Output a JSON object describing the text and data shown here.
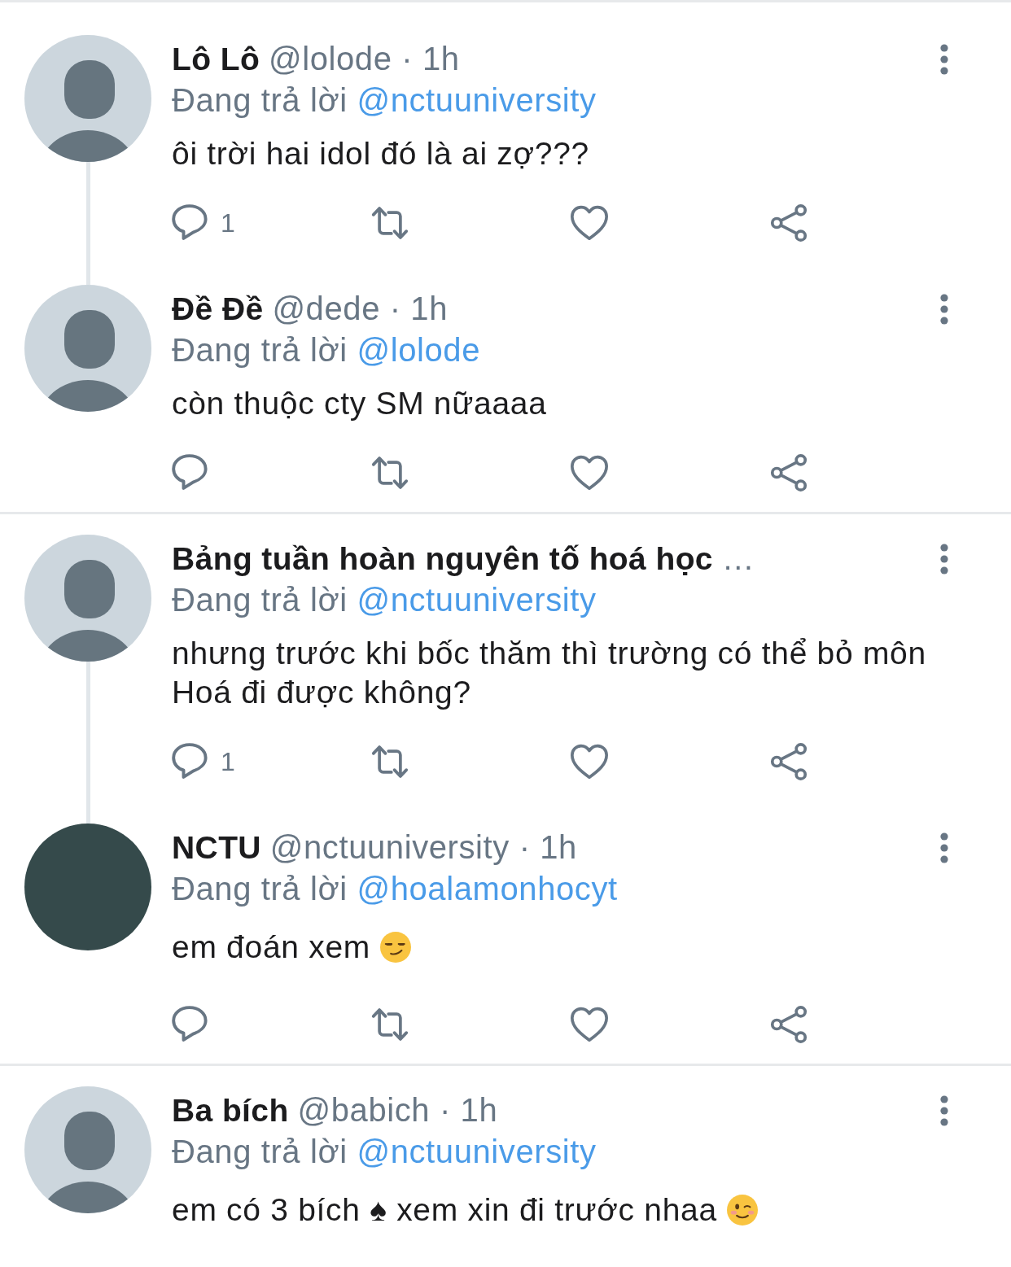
{
  "threads": [
    {
      "tweets": [
        {
          "avatar": {
            "kind": "silhouette"
          },
          "name": "Lô Lô",
          "meta": "@lolode · 1h",
          "reply_label": "Đang trả lời",
          "reply_to": "@nctuuniversity",
          "text": "ôi trời hai idol đó là ai zợ???",
          "thread_line": true,
          "actions": [
            {
              "kind": "reply",
              "count": "1"
            },
            {
              "kind": "retweet"
            },
            {
              "kind": "like"
            },
            {
              "kind": "share"
            }
          ]
        },
        {
          "avatar": {
            "kind": "silhouette"
          },
          "name": "Đề Đề",
          "meta": "@dede · 1h",
          "reply_label": "Đang trả lời",
          "reply_to": "@lolode",
          "text": "còn thuộc cty SM nữaaaa",
          "thread_line": false,
          "actions": [
            {
              "kind": "reply"
            },
            {
              "kind": "retweet"
            },
            {
              "kind": "like"
            },
            {
              "kind": "share"
            }
          ]
        }
      ]
    },
    {
      "tweets": [
        {
          "avatar": {
            "kind": "silhouette"
          },
          "name": "Bảng tuần hoàn nguyên tố hoá học",
          "meta": "…",
          "reply_label": "Đang trả lời",
          "reply_to": "@nctuuniversity",
          "text": "nhưng trước khi bốc thăm thì trường có thể bỏ môn Hoá đi được không?",
          "thread_line": true,
          "actions": [
            {
              "kind": "reply",
              "count": "1"
            },
            {
              "kind": "retweet"
            },
            {
              "kind": "like"
            },
            {
              "kind": "share"
            }
          ]
        },
        {
          "avatar": {
            "kind": "photo"
          },
          "name": "NCTU",
          "meta": "@nctuuniversity · 1h",
          "reply_label": "Đang trả lời",
          "reply_to": "@hoalamonhocyt",
          "text": "em đoán xem",
          "emoji": {
            "kind": "smirk"
          },
          "thread_line": false,
          "actions": [
            {
              "kind": "reply"
            },
            {
              "kind": "retweet"
            },
            {
              "kind": "like"
            },
            {
              "kind": "share"
            }
          ]
        }
      ]
    },
    {
      "tweets": [
        {
          "avatar": {
            "kind": "silhouette"
          },
          "name": "Ba bích",
          "meta": "@babich · 1h",
          "reply_label": "Đang trả lời",
          "reply_to": "@nctuuniversity",
          "text": "em có 3 bích ♠ xem xin đi trước nhaa",
          "emoji": {
            "kind": "wink"
          },
          "thread_line": false
        }
      ]
    }
  ]
}
